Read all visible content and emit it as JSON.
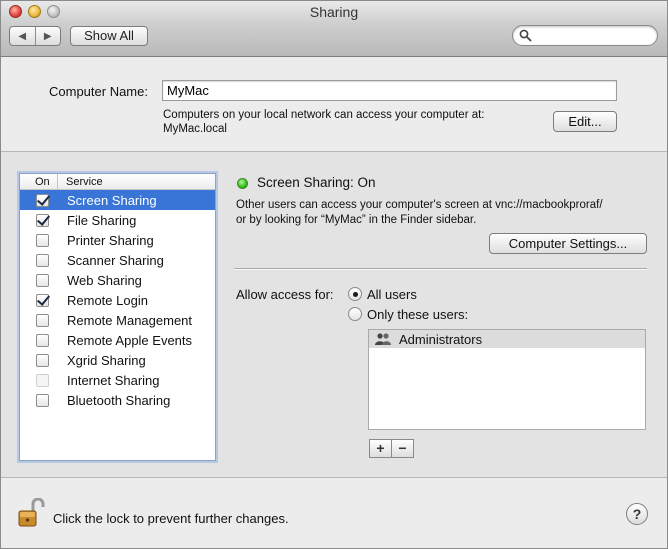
{
  "window": {
    "title": "Sharing"
  },
  "toolbar": {
    "back_glyph": "◀",
    "forward_glyph": "▶",
    "show_all_label": "Show All",
    "search_placeholder": "",
    "search_value": ""
  },
  "computer_name": {
    "label": "Computer Name:",
    "value": "MyMac",
    "description_line1": "Computers on your local network can access your computer at:",
    "description_line2": "MyMac.local",
    "edit_label": "Edit..."
  },
  "services": {
    "header_on": "On",
    "header_service": "Service",
    "items": [
      {
        "label": "Screen Sharing",
        "checked": true,
        "enabled": true,
        "selected": true
      },
      {
        "label": "File Sharing",
        "checked": true,
        "enabled": true,
        "selected": false
      },
      {
        "label": "Printer Sharing",
        "checked": false,
        "enabled": true,
        "selected": false
      },
      {
        "label": "Scanner Sharing",
        "checked": false,
        "enabled": true,
        "selected": false
      },
      {
        "label": "Web Sharing",
        "checked": false,
        "enabled": true,
        "selected": false
      },
      {
        "label": "Remote Login",
        "checked": true,
        "enabled": true,
        "selected": false
      },
      {
        "label": "Remote Management",
        "checked": false,
        "enabled": true,
        "selected": false
      },
      {
        "label": "Remote Apple Events",
        "checked": false,
        "enabled": true,
        "selected": false
      },
      {
        "label": "Xgrid Sharing",
        "checked": false,
        "enabled": true,
        "selected": false
      },
      {
        "label": "Internet Sharing",
        "checked": false,
        "enabled": false,
        "selected": false
      },
      {
        "label": "Bluetooth Sharing",
        "checked": false,
        "enabled": true,
        "selected": false
      }
    ]
  },
  "detail": {
    "status_text": "Screen Sharing: On",
    "status_color": "#2fbf16",
    "description_line1": "Other users can access your computer's screen at vnc://macbookproraf/",
    "description_line2": "or by looking for “MyMac” in the Finder sidebar.",
    "computer_settings_label": "Computer Settings...",
    "allow_access_label": "Allow access for:",
    "option_all_users": "All users",
    "option_only_these": "Only these users:",
    "selected_option": "all",
    "users": [
      {
        "name": "Administrators",
        "icon": "group-icon"
      }
    ],
    "add_label": "+",
    "remove_label": "−"
  },
  "footer": {
    "lock_text": "Click the lock to prevent further changes.",
    "help_label": "?"
  },
  "colors": {
    "selection": "#3875d7",
    "window_bg": "#ececec"
  }
}
